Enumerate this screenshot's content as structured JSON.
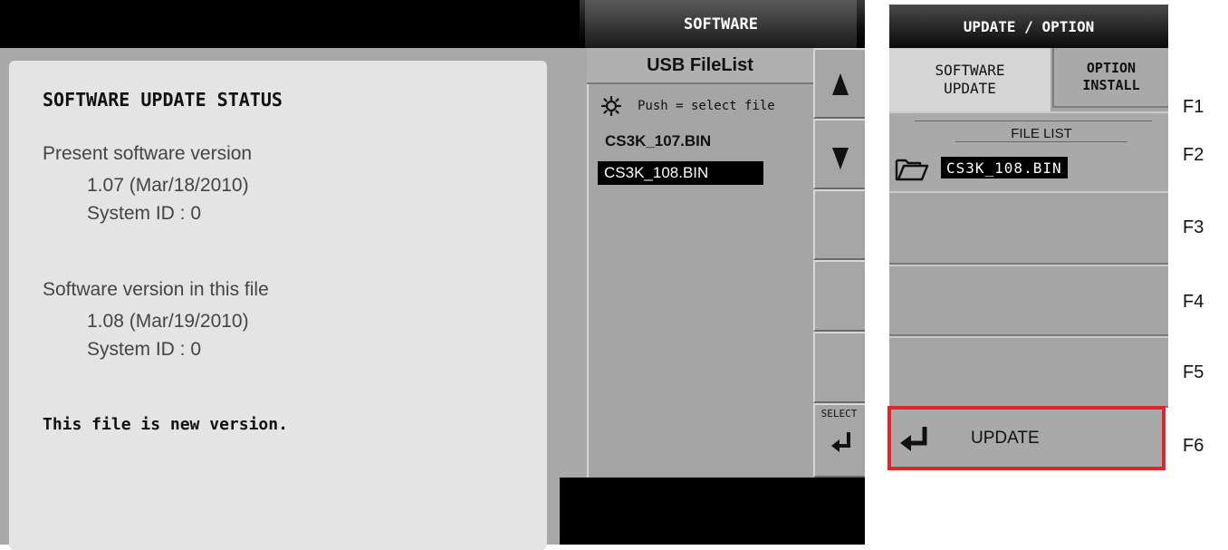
{
  "screen": {
    "software_title": "SOFTWARE",
    "status": {
      "heading": "SOFTWARE UPDATE STATUS",
      "present_label": "Present software version",
      "present_version": "1.07 (Mar/18/2010)",
      "present_system_id": "System ID : 0",
      "file_label": "Software version in this file",
      "file_version": "1.08 (Mar/19/2010)",
      "file_system_id": "System ID : 0",
      "message": "This file is new version."
    },
    "usb": {
      "title": "USB FileList",
      "hint": "Push = select file",
      "hint_icon": "knob-icon",
      "files": [
        "CS3K_107.BIN",
        "CS3K_108.BIN"
      ],
      "selected_index": 1
    },
    "scroll": {
      "up_icon": "arrow-up-icon",
      "down_icon": "arrow-down-icon",
      "select_label": "SELECT",
      "select_icon": "enter-icon"
    }
  },
  "menu": {
    "title": "UPDATE / OPTION",
    "tab_software": "SOFTWARE UPDATE",
    "tab_option": "OPTION INSTALL",
    "file_list_label": "FILE LIST",
    "file_list_value": "CS3K_108.BIN",
    "update_label": "UPDATE",
    "highlight_color": "#e1262a"
  },
  "function_keys": [
    "F1",
    "F2",
    "F3",
    "F4",
    "F5",
    "F6"
  ]
}
